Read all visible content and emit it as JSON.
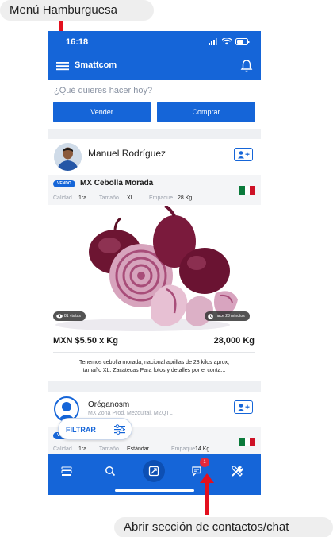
{
  "annotations": {
    "top": "Menú Hamburguesa",
    "bottom": "Abrir sección de contactos/chat",
    "arrow_color": "#e3101e"
  },
  "status_bar": {
    "time": "16:18"
  },
  "app_bar": {
    "title": "Smattcom",
    "menu_icon": "hamburger-icon",
    "bell_icon": "bell-icon"
  },
  "home": {
    "prompt": "¿Qué quieres hacer hoy?",
    "sell_label": "Vender",
    "buy_label": "Comprar"
  },
  "posts": [
    {
      "user_name": "Manuel Rodríguez",
      "badge": "VENDO",
      "product": "MX Cebolla Morada",
      "specs": [
        {
          "label": "Calidad",
          "value": "1ra"
        },
        {
          "label": "Tamaño",
          "value": "XL"
        },
        {
          "label": "Empaque",
          "value": "28 Kg"
        }
      ],
      "views": "81 visitas",
      "time_ago": "hace 23 minutos",
      "price": "MXN $5.50 x Kg",
      "quantity": "28,000 Kg",
      "description_line1": "Tenemos cebolla morada, nacional aprillas de 28 kilos aprox,",
      "description_line2": "tamaño XL. Zacatecas  Para fotos y detalles por el conta..."
    },
    {
      "user_name": "Oréganosm",
      "location": "MX Zona Prod. Mezquital, MZQTL",
      "badge": "VENDO",
      "specs": [
        {
          "label": "Calidad",
          "value": "1ra"
        },
        {
          "label": "Tamaño",
          "value": "Estándar"
        },
        {
          "label": "Empaque",
          "value": "14 Kg"
        }
      ]
    }
  ],
  "filter_label": "FILTRAR",
  "tab_bar": {
    "icons": [
      "list-icon",
      "search-icon",
      "add-post-icon",
      "chat-icon",
      "tools-icon"
    ],
    "notification_count": "1",
    "color": "#1565d8"
  }
}
